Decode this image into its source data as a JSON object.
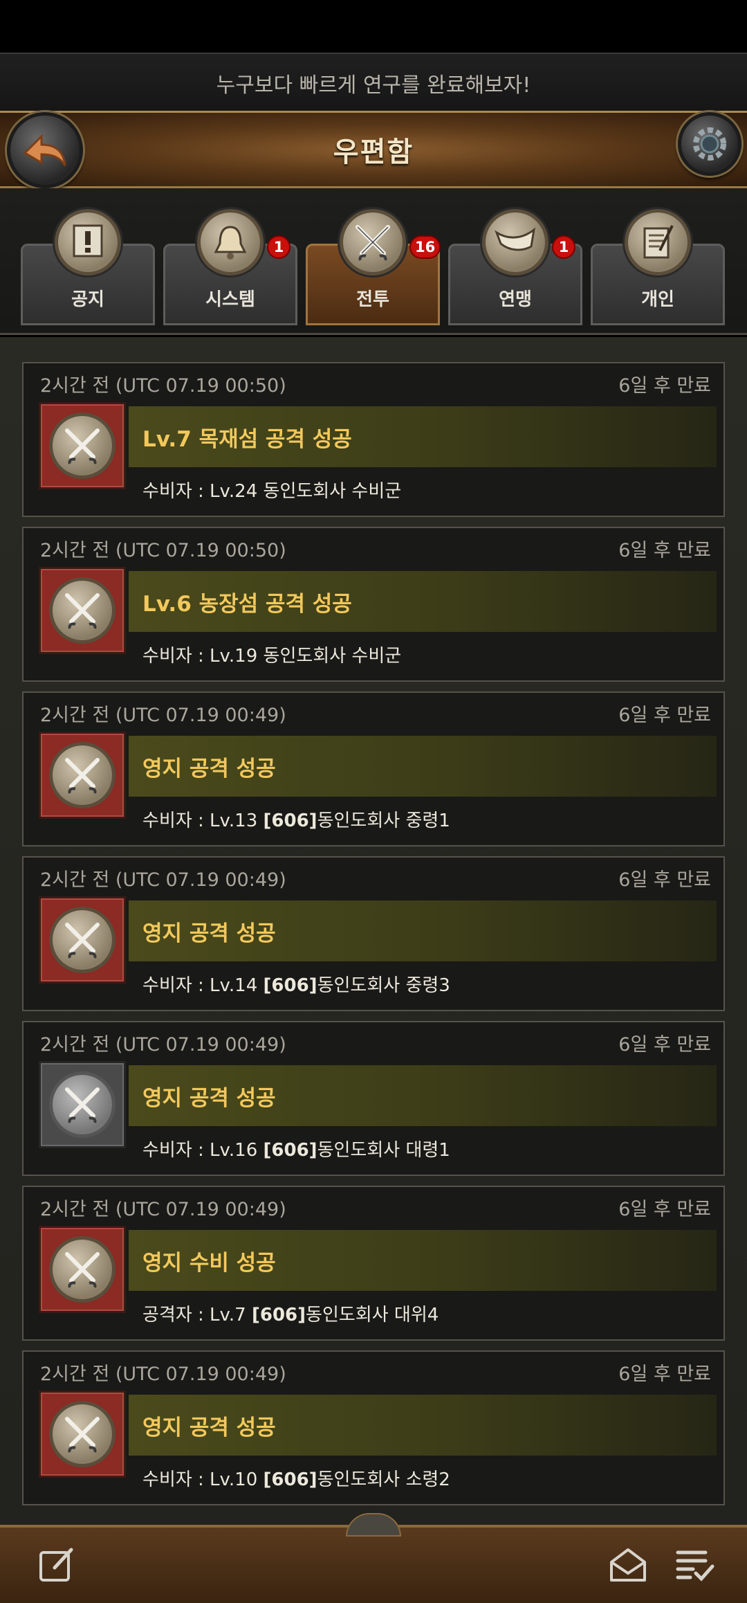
{
  "tip": "누구보다 빠르게 연구를 완료해보자!",
  "title": "우편함",
  "tabs": [
    {
      "label": "공지",
      "badge": ""
    },
    {
      "label": "시스템",
      "badge": "1"
    },
    {
      "label": "전투",
      "badge": "16"
    },
    {
      "label": "연맹",
      "badge": "1"
    },
    {
      "label": "개인",
      "badge": ""
    }
  ],
  "active_tab": "전투",
  "mails": [
    {
      "time": "2시간 전 (UTC 07.19 00:50)",
      "expire": "6일 후 만료",
      "title": "Lv.7 목재섬 공격 성공",
      "sub_prefix": "수비자 : Lv.24 ",
      "sub_tag": "",
      "sub_name": "동인도회사 수비군",
      "icon": "red"
    },
    {
      "time": "2시간 전 (UTC 07.19 00:50)",
      "expire": "6일 후 만료",
      "title": "Lv.6 농장섬 공격 성공",
      "sub_prefix": "수비자 : Lv.19 ",
      "sub_tag": "",
      "sub_name": "동인도회사 수비군",
      "icon": "red"
    },
    {
      "time": "2시간 전 (UTC 07.19 00:49)",
      "expire": "6일 후 만료",
      "title": "영지 공격 성공",
      "sub_prefix": "수비자 : Lv.13 ",
      "sub_tag": "[606]",
      "sub_name": "동인도회사 중령1",
      "icon": "red"
    },
    {
      "time": "2시간 전 (UTC 07.19 00:49)",
      "expire": "6일 후 만료",
      "title": "영지 공격 성공",
      "sub_prefix": "수비자 : Lv.14 ",
      "sub_tag": "[606]",
      "sub_name": "동인도회사 중령3",
      "icon": "red"
    },
    {
      "time": "2시간 전 (UTC 07.19 00:49)",
      "expire": "6일 후 만료",
      "title": "영지 공격 성공",
      "sub_prefix": "수비자 : Lv.16 ",
      "sub_tag": "[606]",
      "sub_name": "동인도회사 대령1",
      "icon": "grey"
    },
    {
      "time": "2시간 전 (UTC 07.19 00:49)",
      "expire": "6일 후 만료",
      "title": "영지 수비 성공",
      "sub_prefix": "공격자 : Lv.7 ",
      "sub_tag": "[606]",
      "sub_name": "동인도회사 대위4",
      "icon": "red"
    },
    {
      "time": "2시간 전 (UTC 07.19 00:49)",
      "expire": "6일 후 만료",
      "title": "영지 공격 성공",
      "sub_prefix": "수비자 : Lv.10 ",
      "sub_tag": "[606]",
      "sub_name": "동인도회사 소령2",
      "icon": "red"
    }
  ],
  "icons": {
    "back": "back-arrow-icon",
    "settings": "gear-icon",
    "compose": "compose-icon",
    "read_all": "open-envelope-icon",
    "select": "checklist-icon"
  },
  "colors": {
    "title_gold": "#f2c95c",
    "badge_red": "#c8100c",
    "active_tab": "#7a4a22"
  }
}
